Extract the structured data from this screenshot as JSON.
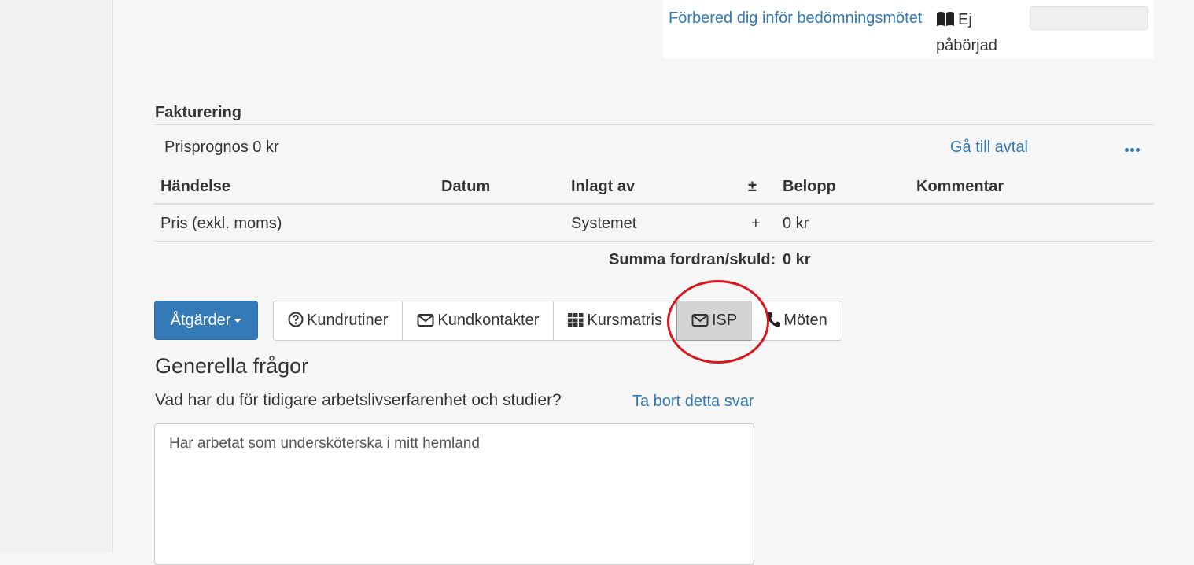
{
  "task": {
    "link_label": "Förbered dig inför bedömningsmötet",
    "status_label": "Ej påbörjad",
    "status_icon": "book-icon"
  },
  "billing": {
    "title": "Fakturering",
    "forecast_label": "Prisprognos 0 kr",
    "agreement_link": "Gå till avtal",
    "more_icon": "more-icon",
    "columns": [
      "Händelse",
      "Datum",
      "Inlagt av",
      "±",
      "Belopp",
      "Kommentar"
    ],
    "rows": [
      {
        "event": "Pris (exkl. moms)",
        "date": "",
        "added_by": "Systemet",
        "sign": "+",
        "amount": "0 kr",
        "comment": ""
      }
    ],
    "sum_label": "Summa fordran/skuld:",
    "sum_value": "0 kr"
  },
  "actions": {
    "dropdown_label": "Åtgärder",
    "tabs": [
      {
        "label": "Kundrutiner",
        "icon": "question-circle-icon"
      },
      {
        "label": "Kundkontakter",
        "icon": "envelope-icon"
      },
      {
        "label": "Kursmatris",
        "icon": "grid-icon"
      },
      {
        "label": "ISP",
        "icon": "envelope-icon",
        "active": true
      },
      {
        "label": "Möten",
        "icon": "phone-icon"
      }
    ],
    "highlight_color": "#d9161c"
  },
  "questions": {
    "section_title": "Generella frågor",
    "items": [
      {
        "question": "Vad har du för tidigare arbetslivserfarenhet och studier?",
        "remove_label": "Ta bort detta svar",
        "answer": "Har arbetat som undersköterska i mitt hemland"
      }
    ]
  },
  "colors": {
    "link": "#337ab7",
    "primary_button": "#337ab7",
    "active_tab": "#d4d4d4"
  }
}
